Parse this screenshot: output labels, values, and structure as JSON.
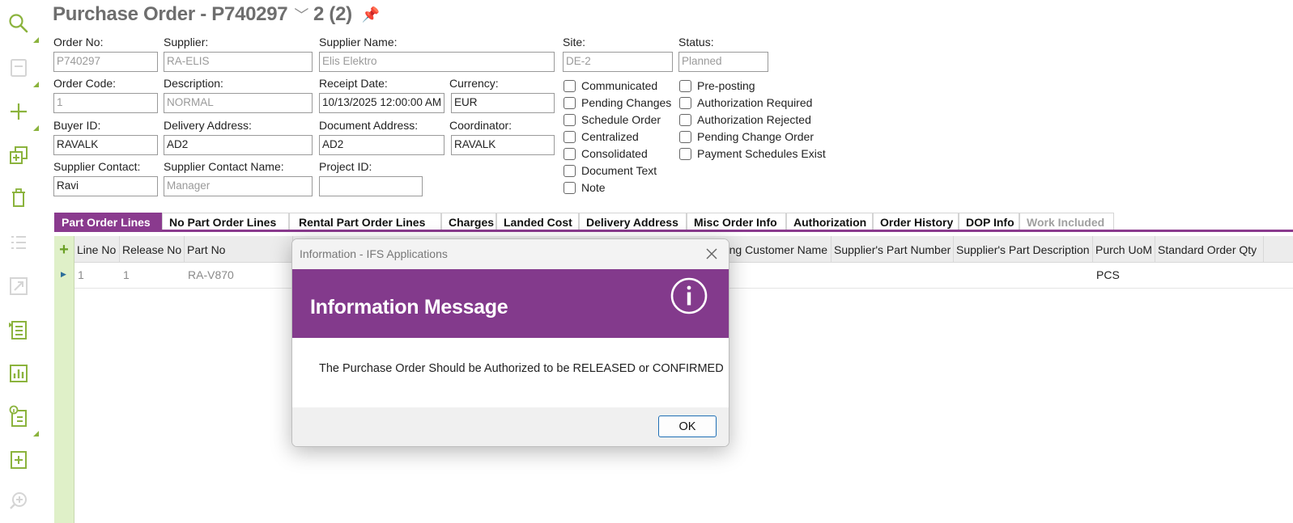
{
  "title": {
    "window_label": "Purchase Order - P740297",
    "record_pos": "2 (2)"
  },
  "toolbar": [
    {
      "icon": "search-icon"
    },
    {
      "icon": "save-icon"
    },
    {
      "icon": "new-icon"
    },
    {
      "icon": "duplicate-icon"
    },
    {
      "icon": "delete-icon"
    },
    {
      "icon": "list-icon"
    },
    {
      "icon": "expand-icon"
    },
    {
      "icon": "document-list-icon"
    },
    {
      "icon": "chart-icon"
    },
    {
      "icon": "info-list-icon"
    },
    {
      "icon": "add-note-icon"
    },
    {
      "icon": "zoom-add-icon"
    }
  ],
  "form": {
    "order_no": {
      "label": "Order No:",
      "value": "P740297"
    },
    "supplier": {
      "label": "Supplier:",
      "value": "RA-ELIS"
    },
    "supplier_name": {
      "label": "Supplier Name:",
      "value": "Elis Elektro"
    },
    "site": {
      "label": "Site:",
      "value": "DE-2"
    },
    "status": {
      "label": "Status:",
      "value": "Planned"
    },
    "order_code": {
      "label": "Order Code:",
      "value": "1"
    },
    "description": {
      "label": "Description:",
      "value": "NORMAL"
    },
    "receipt_date": {
      "label": "Receipt Date:",
      "value": "10/13/2025 12:00:00 AM"
    },
    "currency": {
      "label": "Currency:",
      "value": "EUR"
    },
    "buyer_id": {
      "label": "Buyer ID:",
      "value": "RAVALK"
    },
    "delivery_address": {
      "label": "Delivery Address:",
      "value": "AD2"
    },
    "document_address": {
      "label": "Document Address:",
      "value": "AD2"
    },
    "coordinator": {
      "label": "Coordinator:",
      "value": "RAVALK"
    },
    "supplier_contact": {
      "label": "Supplier Contact:",
      "value": "Ravi"
    },
    "supplier_contact_name": {
      "label": "Supplier Contact Name:",
      "value": "Manager"
    },
    "project_id": {
      "label": "Project ID:",
      "value": ""
    }
  },
  "checkboxes_left": [
    "Communicated",
    "Pending Changes",
    "Schedule Order",
    "Centralized",
    "Consolidated",
    "Document Text",
    "Note"
  ],
  "checkboxes_right": [
    "Pre-posting",
    "Authorization Required",
    "Authorization Rejected",
    "Pending Change Order",
    "Payment Schedules Exist"
  ],
  "tabs": [
    "Part Order Lines",
    "No Part Order Lines",
    "Rental Part Order Lines",
    "Charges",
    "Landed Cost",
    "Delivery Address",
    "Misc Order Info",
    "Authorization",
    "Order History",
    "DOP Info",
    "Work Included"
  ],
  "grid": {
    "columns": [
      "Line No",
      "Release No",
      "Part No",
      "ing Customer Name",
      "Supplier's Part Number",
      "Supplier's Part Description",
      "Purch UoM",
      "Standard Order Qty"
    ],
    "rows": [
      {
        "line_no": "1",
        "release_no": "1",
        "part_no": "RA-V870",
        "purch_uom": "PCS"
      }
    ]
  },
  "dialog": {
    "window_title": "Information - IFS Applications",
    "heading": "Information Message",
    "message": "The Purchase Order Should be Authorized to be RELEASED or CONFIRMED",
    "ok_label": "OK"
  },
  "colors": {
    "accent": "#8a3a8e",
    "toolbar_icon": "#8bb33d",
    "grid_side": "#dff0c8"
  }
}
